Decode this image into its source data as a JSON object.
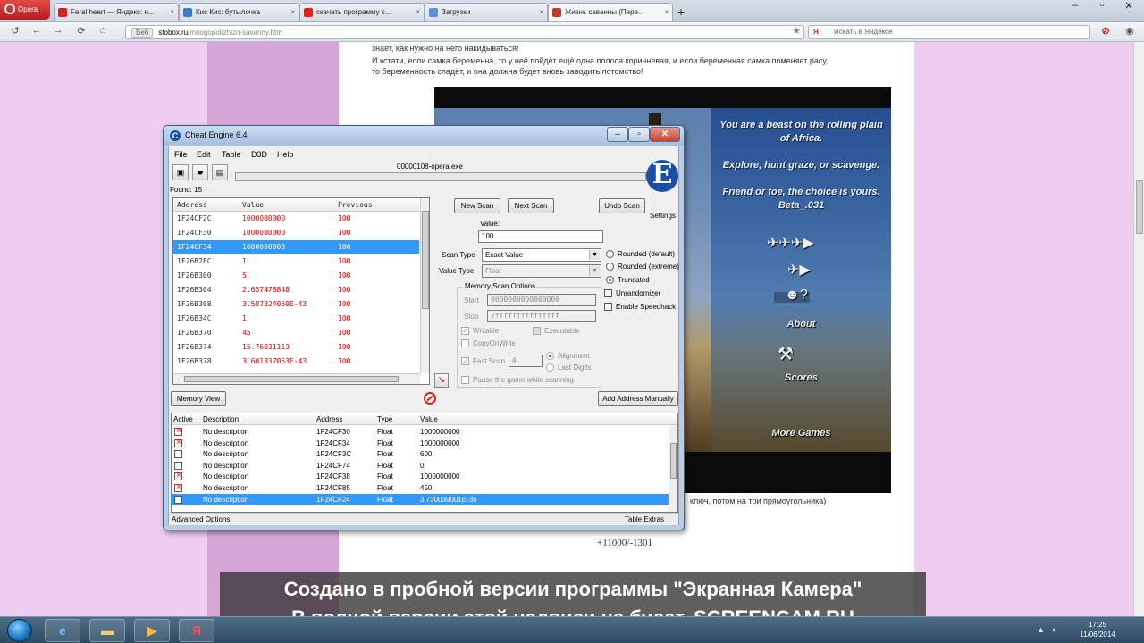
{
  "browser": {
    "menu_label": "Opera",
    "tabs": [
      {
        "title": "Feral heart — Яндекс: н...",
        "color": "#d22"
      },
      {
        "title": "Кис Кис: бутылочка",
        "color": "#3a78c8"
      },
      {
        "title": "скачать программу с...",
        "color": "#d22"
      },
      {
        "title": "Загрузки",
        "color": "#5c8fd6"
      },
      {
        "title": "Жизнь саванны (Пере...",
        "color": "#c0392b"
      }
    ],
    "address_pill": "Веб",
    "address_domain": "stobox.ru",
    "address_path": "/moogopol/zhizn-savanny.htm",
    "search_placeholder": "Искать в Яндексе"
  },
  "page": {
    "text_top": "знает, как нужно на него накидываться!",
    "text_p1": "И кстати, если самка беременна, то у неё пойдёт ещё одна полоса коричневая, и если беременная самка поменяет расу,",
    "text_p2": "то беременность спадёт, и она должна будет вновь заводить потомство!",
    "text_below": "ключ, потом на три прямоугольника)",
    "code_text": "+11000/-1301"
  },
  "game": {
    "line1": "You are a beast on the rolling plain",
    "line2": "of Africa.",
    "line3": "Explore, hunt graze, or scavenge.",
    "line4": "Friend or foe, the choice is yours.",
    "line5": "Beta_.031",
    "menu_about": "About",
    "menu_scores": "Scores",
    "menu_more": "More Games",
    "icons": [
      "animals-icon",
      "play-icon",
      "help-icon",
      "tools-icon"
    ]
  },
  "cheatengine": {
    "title": "Cheat Engine 6.4",
    "menu": [
      "File",
      "Edit",
      "Table",
      "D3D",
      "Help"
    ],
    "process": "00000108-opera.exe",
    "found": "Found: 15",
    "columns": [
      "Address",
      "Value",
      "Previous"
    ],
    "results": [
      {
        "address": "1F24CF2C",
        "value": "1000000000",
        "previous": "100"
      },
      {
        "address": "1F24CF30",
        "value": "1000000000",
        "previous": "100"
      },
      {
        "address": "1F24CF34",
        "value": "1000000000",
        "previous": "100"
      },
      {
        "address": "1F26B2FC",
        "value": "1",
        "previous": "100"
      },
      {
        "address": "1F26B300",
        "value": "5",
        "previous": "100"
      },
      {
        "address": "1F26B304",
        "value": "2.657478848",
        "previous": "100"
      },
      {
        "address": "1F26B308",
        "value": "3.587324069E-43",
        "previous": "100"
      },
      {
        "address": "1F26B34C",
        "value": "1",
        "previous": "100"
      },
      {
        "address": "1F26B370",
        "value": "45",
        "previous": "100"
      },
      {
        "address": "1F26B374",
        "value": "15.76031113",
        "previous": "100"
      },
      {
        "address": "1F26B378",
        "value": "3.601337053E-43",
        "previous": "100"
      }
    ],
    "selected_result": 2,
    "btn_new_scan": "New Scan",
    "btn_next_scan": "Next Scan",
    "btn_undo_scan": "Undo Scan",
    "settings_label": "Settings",
    "value_label": "Value:",
    "value_input": "100",
    "scan_type_label": "Scan Type",
    "scan_type_value": "Exact Value",
    "value_type_label": "Value Type",
    "value_type_value": "Float",
    "rounded_default": "Rounded (default)",
    "rounded_extreme": "Rounded (extreme)",
    "truncated": "Truncated",
    "unrandomizer": "Unrandomizer",
    "speedhack": "Enable Speedhack",
    "memory_scan_options": "Memory Scan Options",
    "start_label": "Start",
    "start_value": "0000000000000000",
    "stop_label": "Stop",
    "stop_value": "7fffffffffffffff",
    "writable": "Writable",
    "executable": "Executable",
    "copyonwrite": "CopyOnWrite",
    "fast_scan": "Fast Scan",
    "fast_scan_value": "4",
    "alignment": "Alignment",
    "last_digits": "Last Digits",
    "pause_game": "Pause the game while scanning",
    "btn_memory_view": "Memory View",
    "btn_add_address": "Add Address Manually",
    "table_columns": [
      "Active",
      "Description",
      "Address",
      "Type",
      "Value"
    ],
    "table_rows": [
      {
        "active": true,
        "description": "No description",
        "address": "1F24CF30",
        "type": "Float",
        "value": "1000000000"
      },
      {
        "active": true,
        "description": "No description",
        "address": "1F24CF34",
        "type": "Float",
        "value": "1000000000"
      },
      {
        "active": false,
        "description": "No description",
        "address": "1F24CF3C",
        "type": "Float",
        "value": "600"
      },
      {
        "active": false,
        "description": "No description",
        "address": "1F24CF74",
        "type": "Float",
        "value": "0"
      },
      {
        "active": true,
        "description": "No description",
        "address": "1F24CF38",
        "type": "Float",
        "value": "1000000000"
      },
      {
        "active": true,
        "description": "No description",
        "address": "1F24CF85",
        "type": "Float",
        "value": "450"
      },
      {
        "active": false,
        "description": "No description",
        "address": "1F24CF24",
        "type": "Float",
        "value": "3.730039001E-35"
      }
    ],
    "selected_table_row": 6,
    "advanced_options": "Advanced Options",
    "table_extras": "Table Extras"
  },
  "watermark": {
    "line1": "Создано в пробной версии программы \"Экранная Камера\"",
    "line2": "В полной версии этой надписи не будет. SCREENCAM.RU"
  },
  "taskbar": {
    "apps": [
      "ie-icon",
      "explorer-icon",
      "media-icon",
      "opera-icon",
      "yandex-icon",
      "cheatengine-icon"
    ],
    "yandex_label": "Я",
    "time": "17:25",
    "date": "11/06/2014"
  }
}
